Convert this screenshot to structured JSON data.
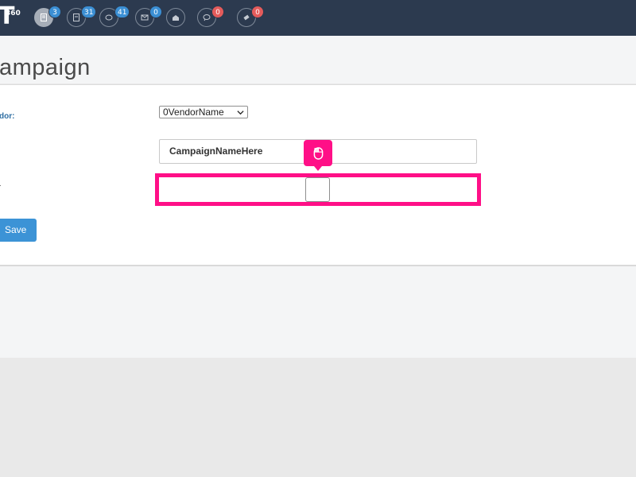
{
  "app": {
    "brand_number": "360"
  },
  "topbar": {
    "badges": [
      "3",
      "31",
      "41",
      "0",
      "0",
      "0"
    ],
    "icons": [
      "document-icon",
      "document-alt-icon",
      "chat-bubbles-icon",
      "mail-icon",
      "open-mail-icon",
      "speech-bubble-icon",
      "ticket-icon"
    ],
    "colors": {
      "bar": "#2c3a4f",
      "badge_blue": "#3b8fd4",
      "badge_red": "#e45b5b"
    }
  },
  "page": {
    "title": "ampaign"
  },
  "form": {
    "vendor_label": "dor:",
    "vendor_selected": "0VendorName",
    "campaign_name_value": "CampaignNameHere",
    "third_row_label": ".",
    "save_label": "Save"
  },
  "overlay": {
    "highlight_color": "#ff0f87",
    "pointer_icon": "mouse-icon"
  }
}
